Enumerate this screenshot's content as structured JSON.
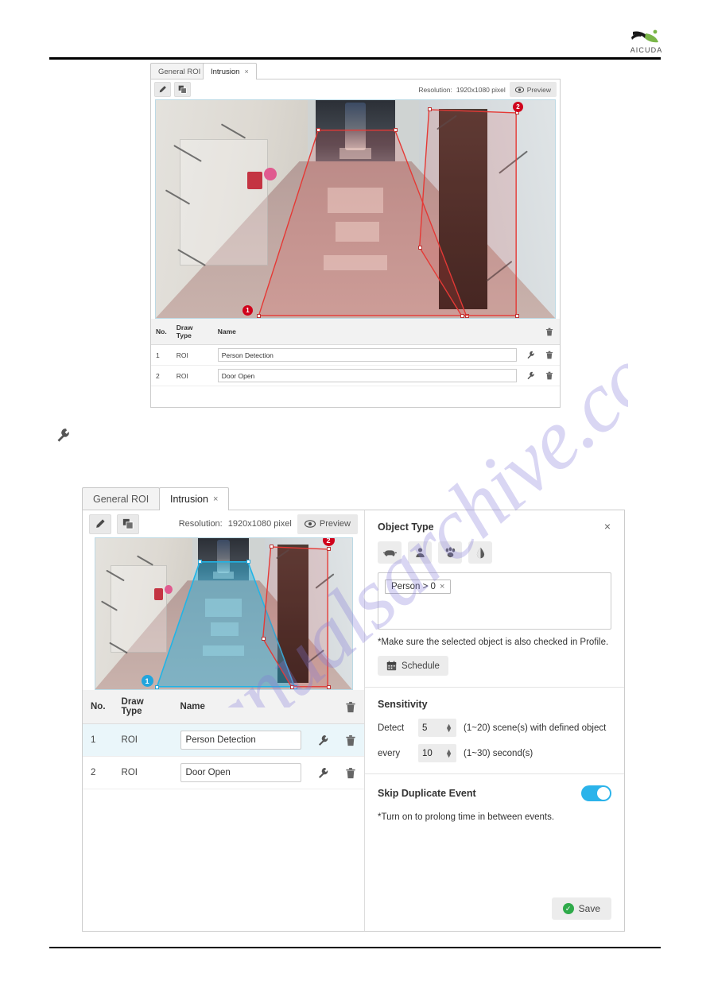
{
  "document": {
    "brand": "AICUDA",
    "watermark": "manualsarchive.com"
  },
  "figure_top": {
    "tabs": [
      {
        "label": "General ROI",
        "closable": false,
        "active": false
      },
      {
        "label": "Intrusion",
        "closable": true,
        "close_glyph": "×",
        "active": true
      }
    ],
    "toolbar": {
      "edit_icon": "pencil-icon",
      "copy_icon": "copy-icon",
      "resolution_label": "Resolution:",
      "resolution_value": "1920x1080 pixel",
      "preview_label": "Preview",
      "preview_icon": "eye-icon"
    },
    "video": {
      "roi_badges": [
        {
          "number": "1",
          "color": "#d0021b"
        },
        {
          "number": "2",
          "color": "#d0021b"
        }
      ]
    },
    "table": {
      "headers": [
        "No.",
        "Draw Type",
        "Name",
        "",
        ""
      ],
      "header_delete_icon": "trash-icon",
      "rows": [
        {
          "no": "1",
          "draw_type": "ROI",
          "name": "Person Detection",
          "config_icon": "wrench-icon",
          "delete_icon": "trash-icon",
          "selected": false
        },
        {
          "no": "2",
          "draw_type": "ROI",
          "name": "Door Open",
          "config_icon": "wrench-icon",
          "delete_icon": "trash-icon",
          "selected": false
        }
      ]
    }
  },
  "standalone_icon": {
    "name": "wrench-icon"
  },
  "figure_bottom": {
    "tabs": [
      {
        "label": "General ROI",
        "closable": false,
        "active": false
      },
      {
        "label": "Intrusion",
        "closable": true,
        "close_glyph": "×",
        "active": true
      }
    ],
    "toolbar": {
      "edit_icon": "pencil-icon",
      "copy_icon": "copy-icon",
      "resolution_label": "Resolution:",
      "resolution_value": "1920x1080 pixel",
      "preview_label": "Preview",
      "preview_icon": "eye-icon"
    },
    "video": {
      "roi_badges": [
        {
          "number": "1",
          "color": "#22a5dd"
        },
        {
          "number": "2",
          "color": "#d0021b"
        }
      ]
    },
    "table": {
      "headers": [
        "No.",
        "Draw Type",
        "Name",
        "",
        ""
      ],
      "header_delete_icon": "trash-icon",
      "rows": [
        {
          "no": "1",
          "draw_type": "ROI",
          "name": "Person Detection",
          "config_icon": "wrench-icon",
          "delete_icon": "trash-icon",
          "selected": true
        },
        {
          "no": "2",
          "draw_type": "ROI",
          "name": "Door Open",
          "config_icon": "wrench-icon",
          "delete_icon": "trash-icon",
          "selected": false
        }
      ]
    },
    "settings": {
      "close_glyph": "×",
      "object_type": {
        "title": "Object Type",
        "buttons": [
          {
            "icon": "car-icon",
            "label": "Vehicle",
            "selected": false
          },
          {
            "icon": "person-icon",
            "label": "Person",
            "selected": false
          },
          {
            "icon": "paw-icon",
            "label": "Animal",
            "selected": false
          },
          {
            "icon": "droplet-icon",
            "label": "Liquid",
            "selected": false
          }
        ],
        "tags": [
          {
            "text": "Person > 0",
            "remove_glyph": "×"
          }
        ],
        "note": "*Make sure the selected object is also checked in Profile.",
        "schedule_label": "Schedule",
        "schedule_icon": "calendar-icon"
      },
      "sensitivity": {
        "title": "Sensitivity",
        "detect_label": "Detect",
        "detect_value": "5",
        "detect_hint": "(1~20) scene(s) with defined object",
        "every_label": "every",
        "every_value": "10",
        "every_hint": "(1~30) second(s)"
      },
      "skip_duplicate": {
        "title": "Skip Duplicate Event",
        "enabled": true,
        "note": "*Turn on to prolong time in between events."
      },
      "save_label": "Save",
      "save_icon": "check-circle-icon"
    }
  },
  "colors": {
    "accent_blue": "#2bb3ea",
    "roi_red": "#d0021b",
    "roi_cyan": "#22a5dd",
    "save_green": "#2faa4a"
  }
}
